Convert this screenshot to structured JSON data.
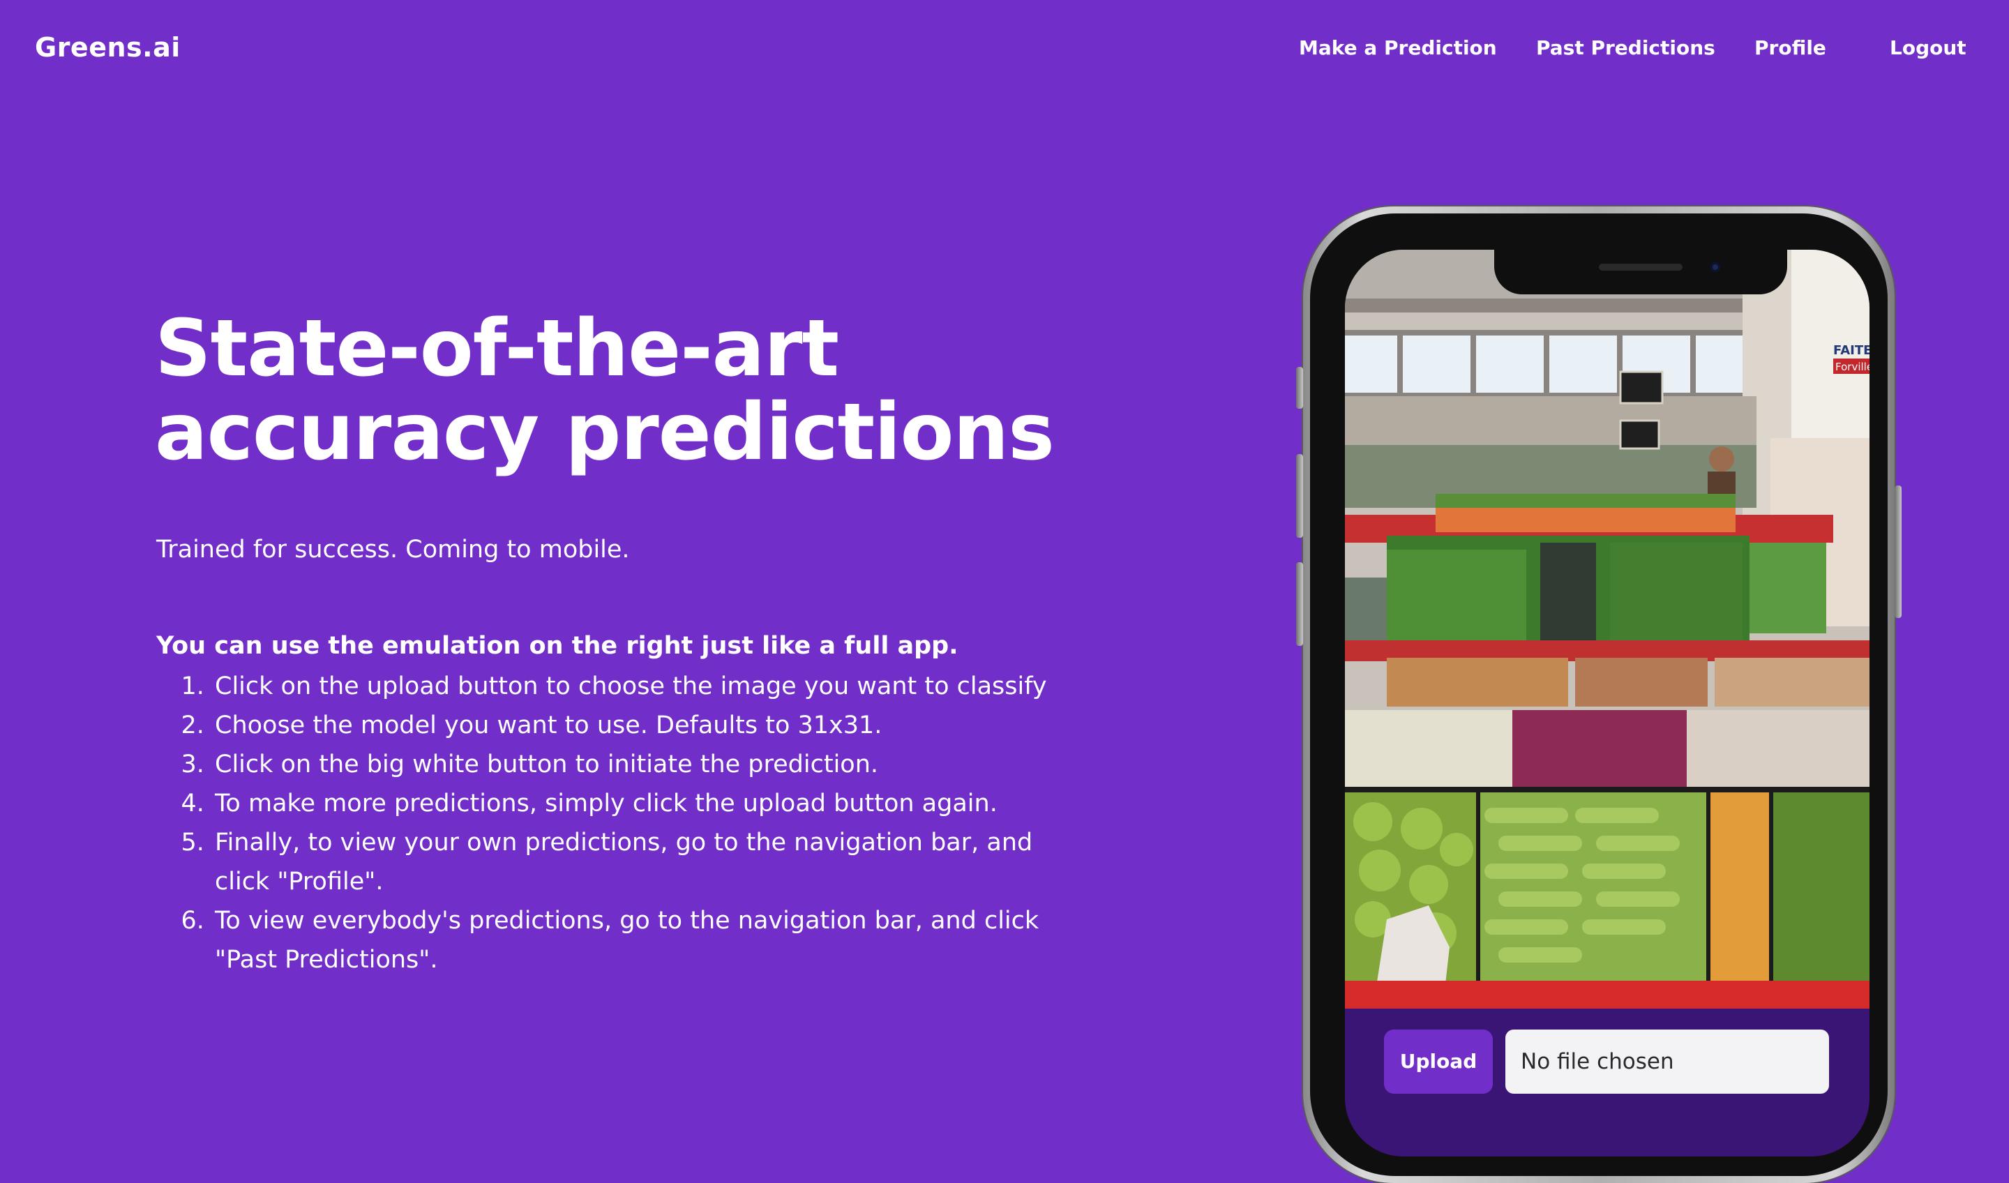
{
  "brand": "Greens.ai",
  "nav": {
    "items": [
      {
        "label": "Make a Prediction"
      },
      {
        "label": "Past Predictions"
      },
      {
        "label": "Profile"
      },
      {
        "label": "Logout"
      }
    ]
  },
  "hero": {
    "title_line1": "State-of-the-art",
    "title_line2": "accuracy predictions",
    "subtitle": "Trained for success. Coming to mobile."
  },
  "instructions": {
    "heading": "You can use the emulation on the right just like a full app.",
    "steps": [
      "Click on the upload button to choose the image you want to classify",
      "Choose the model you want to use. Defaults to 31x31.",
      "Click on the big white button to initiate the prediction.",
      "To make more predictions, simply click the upload button again.",
      "Finally, to view your own predictions, go to the navigation bar, and click \"Profile\".",
      "To view everybody's predictions, go to the navigation bar, and click \"Past Predictions\"."
    ]
  },
  "phone": {
    "upload_label": "Upload",
    "file_status": "No file chosen",
    "photo_sign_text": "FAITES",
    "photo_sign_subtext": "Forville"
  },
  "colors": {
    "background": "#722ec8",
    "phone_panel": "#3a1575",
    "button": "#722ec8",
    "text": "#ffffff"
  }
}
